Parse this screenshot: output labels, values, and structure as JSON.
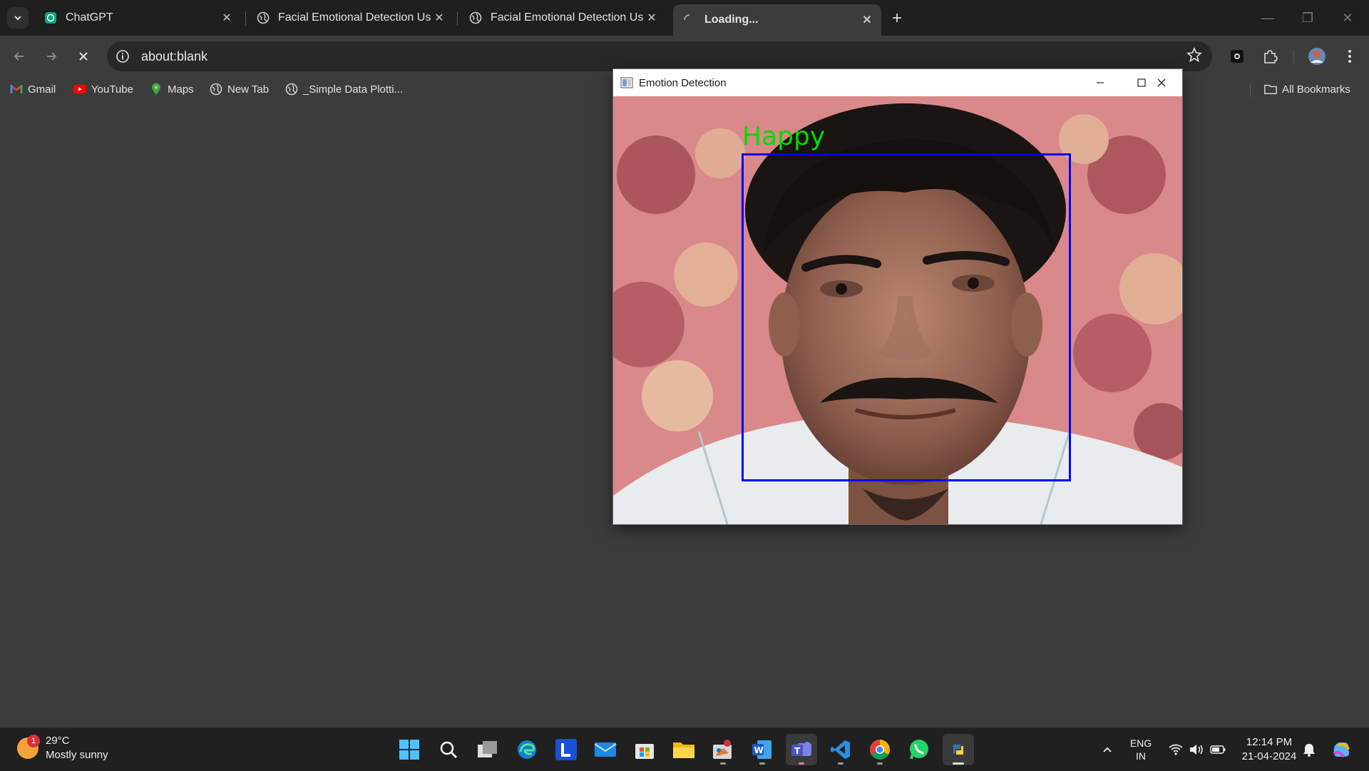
{
  "browser": {
    "tabs": [
      {
        "title": "ChatGPT",
        "icon": "chatgpt-icon"
      },
      {
        "title": "Facial Emotional Detection Usi",
        "icon": "globe-icon"
      },
      {
        "title": "Facial Emotional Detection Usi",
        "icon": "globe-icon"
      },
      {
        "title": "Loading...",
        "icon": "loading-spinner-icon",
        "active": true
      }
    ],
    "new_tab_label": "+",
    "url": "about:blank",
    "bookmarks": [
      {
        "label": "Gmail",
        "icon": "gmail-icon"
      },
      {
        "label": "YouTube",
        "icon": "youtube-icon"
      },
      {
        "label": "Maps",
        "icon": "maps-icon"
      },
      {
        "label": "New Tab",
        "icon": "globe-icon"
      },
      {
        "label": "_Simple Data Plotti...",
        "icon": "globe-icon"
      }
    ],
    "all_bookmarks_label": "All Bookmarks"
  },
  "emotion_window": {
    "title": "Emotion Detection",
    "detected_emotion": "Happy",
    "box_color": "#0000ff",
    "label_color": "#00dd00"
  },
  "taskbar": {
    "weather": {
      "badge": "1",
      "temp": "29°C",
      "condition": "Mostly sunny"
    },
    "apps": [
      "start-icon",
      "search-icon",
      "task-view-icon",
      "edge-icon",
      "l-app-icon",
      "mail-icon",
      "store-icon",
      "file-explorer-icon",
      "paint-icon",
      "word-icon",
      "teams-icon",
      "vscode-icon",
      "chrome-icon",
      "whatsapp-icon",
      "python-icon"
    ],
    "language": {
      "line1": "ENG",
      "line2": "IN"
    },
    "clock": {
      "time": "12:14 PM",
      "date": "21-04-2024"
    }
  }
}
